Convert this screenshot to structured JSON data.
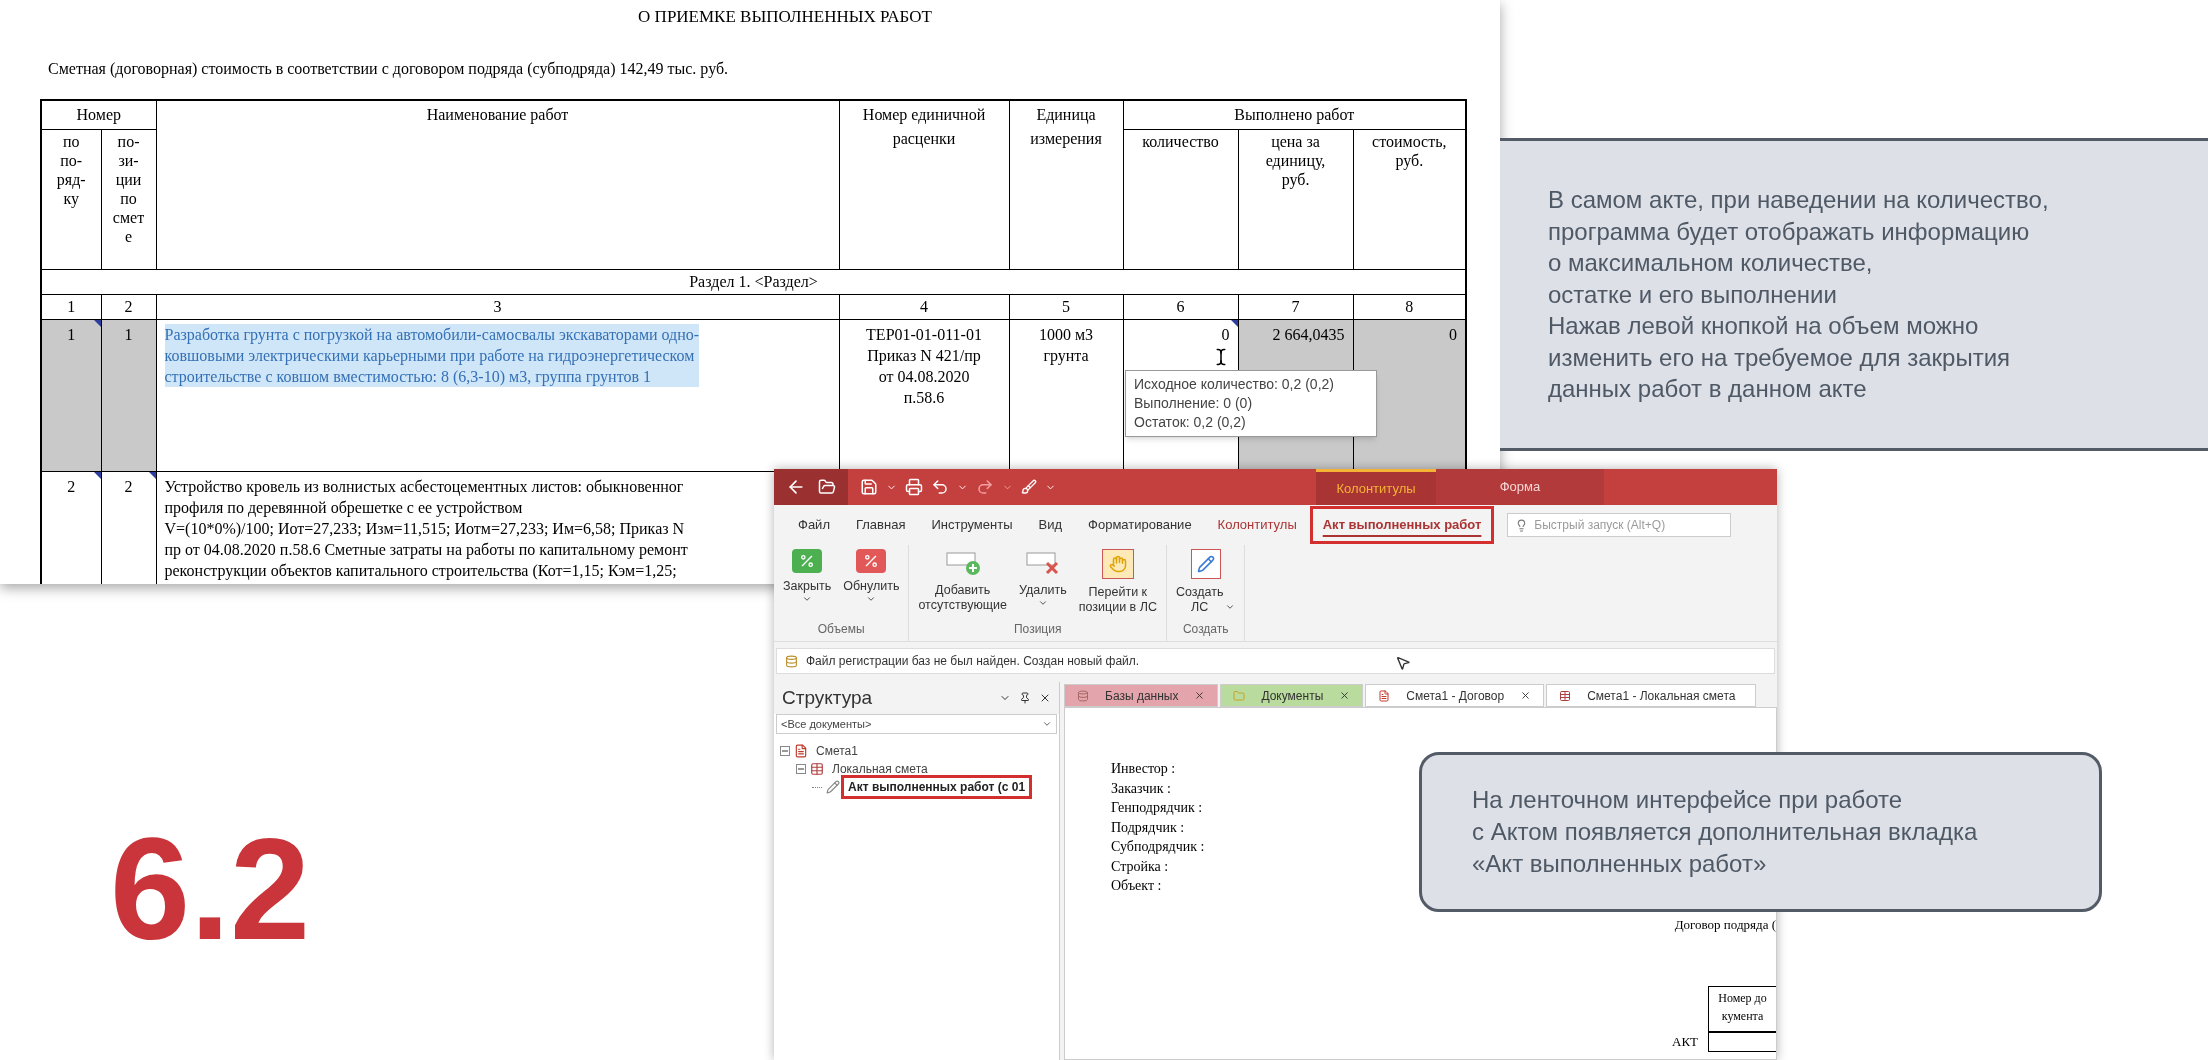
{
  "slide_number": "6.2",
  "document": {
    "title": "О ПРИЕМКЕ ВЫПОЛНЕННЫХ РАБОТ",
    "cost_line": "Сметная (договорная) стоимость в соответствии с договором подряда (субподряда) 142,49 тыс. руб.",
    "group_headers": [
      "Номер",
      "Выполнено работ"
    ],
    "columns": [
      {
        "label": "по\nпо-\nряд-\nку"
      },
      {
        "label": "по-\nзи-\nции\nпо\nсмет\nе"
      },
      {
        "label": "Наименование работ"
      },
      {
        "label": "Номер единичной\nрасценки"
      },
      {
        "label": "Единица\nизмерения"
      },
      {
        "label": "количество"
      },
      {
        "label": "цена за\nединицу,\nруб."
      },
      {
        "label": "стоимость,\nруб."
      }
    ],
    "section": "Раздел 1. <Раздел>",
    "column_numbers": [
      "1",
      "2",
      "3",
      "4",
      "5",
      "6",
      "7",
      "8"
    ],
    "rows": [
      {
        "cells": [
          {
            "text": "1",
            "shaded": true,
            "marker": true
          },
          {
            "text": "1",
            "shaded": true,
            "marker": false
          },
          {
            "text": "Разработка грунта с погрузкой на автомобили-самосвалы экскаваторами одно-\nковшовыми электрическими карьерными при работе на гидроэнергетическом\nстроительстве с ковшом вместимостью: 8 (6,3-10) м3, группа грунтов 1",
            "shaded": false,
            "marker": false,
            "highlighted": true
          },
          {
            "text": "ТЕР01-01-011-01\nПриказ N 421/пр\nот 04.08.2020\nп.58.6",
            "shaded": false,
            "marker": false
          },
          {
            "text": "1000 м3\nгрунта",
            "shaded": false,
            "marker": false
          },
          {
            "text": "0",
            "shaded": false,
            "marker": true
          },
          {
            "text": "2 664,0435",
            "shaded": true,
            "marker": false
          },
          {
            "text": "0",
            "shaded": true,
            "marker": false
          }
        ]
      },
      {
        "cells": [
          {
            "text": "2",
            "shaded": false,
            "marker": true
          },
          {
            "text": "2",
            "shaded": false,
            "marker": true
          },
          {
            "text": "Устройство кровель из волнистых асбестоцементных листов: обыкновенног\nпрофиля по деревянной обрешетке с ее устройством\nV=(10*0%)/100; Иот=27,233; Изм=11,515; Иотм=27,233; Им=6,58; Приказ N\nпр от 04.08.2020 п.58.6 Сметные затраты на работы по капитальному ремонт\nреконструкции объектов капитального строительства (Кот=1,15; Кэм=1,25;",
            "shaded": false,
            "marker": false,
            "highlighted": false
          }
        ]
      }
    ],
    "tooltip": [
      "Исходное количество: 0,2 (0,2)",
      "Выполнение: 0 (0)",
      "Остаток: 0,2 (0,2)"
    ]
  },
  "app": {
    "context_groups": [
      {
        "label": "Колонтитулы",
        "color": "#f5b335"
      },
      {
        "label": "Форма",
        "color": "#f6d5d5"
      }
    ],
    "tabs": [
      {
        "label": "Файл",
        "kind": "standard",
        "selected": false,
        "outlined": false
      },
      {
        "label": "Главная",
        "kind": "standard",
        "selected": false,
        "outlined": false
      },
      {
        "label": "Инструменты",
        "kind": "standard",
        "selected": false,
        "outlined": false
      },
      {
        "label": "Вид",
        "kind": "standard",
        "selected": false,
        "outlined": false
      },
      {
        "label": "Форматирование",
        "kind": "standard",
        "selected": false,
        "outlined": false
      },
      {
        "label": "Колонтитулы",
        "kind": "contextual",
        "selected": false,
        "outlined": false
      },
      {
        "label": "Акт выполненных работ",
        "kind": "contextual",
        "selected": true,
        "outlined": true
      }
    ],
    "search": {
      "placeholder": "Быстрый запуск (Alt+Q)"
    },
    "groups": [
      {
        "label": "Объемы",
        "buttons": [
          {
            "label": "Закрыть",
            "dropdown": true
          },
          {
            "label": "Обнулить",
            "dropdown": true
          }
        ]
      },
      {
        "label": "Позиция",
        "buttons": [
          {
            "label": "Добавить\nотсутствующие",
            "dropdown": false
          },
          {
            "label": "Удалить",
            "dropdown": true
          },
          {
            "label": "Перейти к\nпозиции в ЛС",
            "dropdown": false
          }
        ]
      },
      {
        "label": "Создать",
        "buttons": [
          {
            "label": "Создать\nЛС",
            "dropdown": true
          }
        ]
      }
    ],
    "message": "Файл регистрации баз не был найден. Создан новый файл.",
    "structure": {
      "title": "Структура",
      "filter": "<Все документы>",
      "tree": [
        {
          "label": "Смета1",
          "expanded": true,
          "selected": false,
          "outlined": false,
          "children": [
            {
              "label": "Локальная смета",
              "expanded": true,
              "selected": false,
              "outlined": false,
              "children": [
                {
                  "label": "Акт выполненных работ (с 01",
                  "selected": true,
                  "outlined": true
                }
              ]
            }
          ]
        }
      ]
    },
    "doc_tabs": [
      {
        "label": "Базы данных",
        "color": "#e3a5ab",
        "closable": true
      },
      {
        "label": "Документы",
        "color": "#b9db9e",
        "closable": true
      },
      {
        "label": "Смета1 - Договор",
        "color": "#ffffff",
        "closable": true
      },
      {
        "label": "Смета1 - Локальная смета",
        "color": "#ffffff",
        "closable": false
      }
    ],
    "fields": [
      "Инвестор :",
      "Заказчик :",
      "Генподрядчик :",
      "Подрядчик :",
      "Субподрядчик :",
      "Стройка :",
      "Объект :"
    ],
    "contract_label": "Договор подряда (",
    "doc_number_header": "Номер до\nкумента",
    "act_label": "АКТ"
  },
  "notes": [
    "В самом акте, при наведении на количество,\nпрограмма будет отображать информацию\nо максимальном количестве,\nостатке и его выполнении\nНажав левой кнопкой на объем можно\nизменить его на требуемое для закрытия\nданных работ в данном акте",
    "На ленточном интерфейсе при работе\nс Актом появляется дополнительная вкладка\n«Акт выполненных работ»"
  ]
}
